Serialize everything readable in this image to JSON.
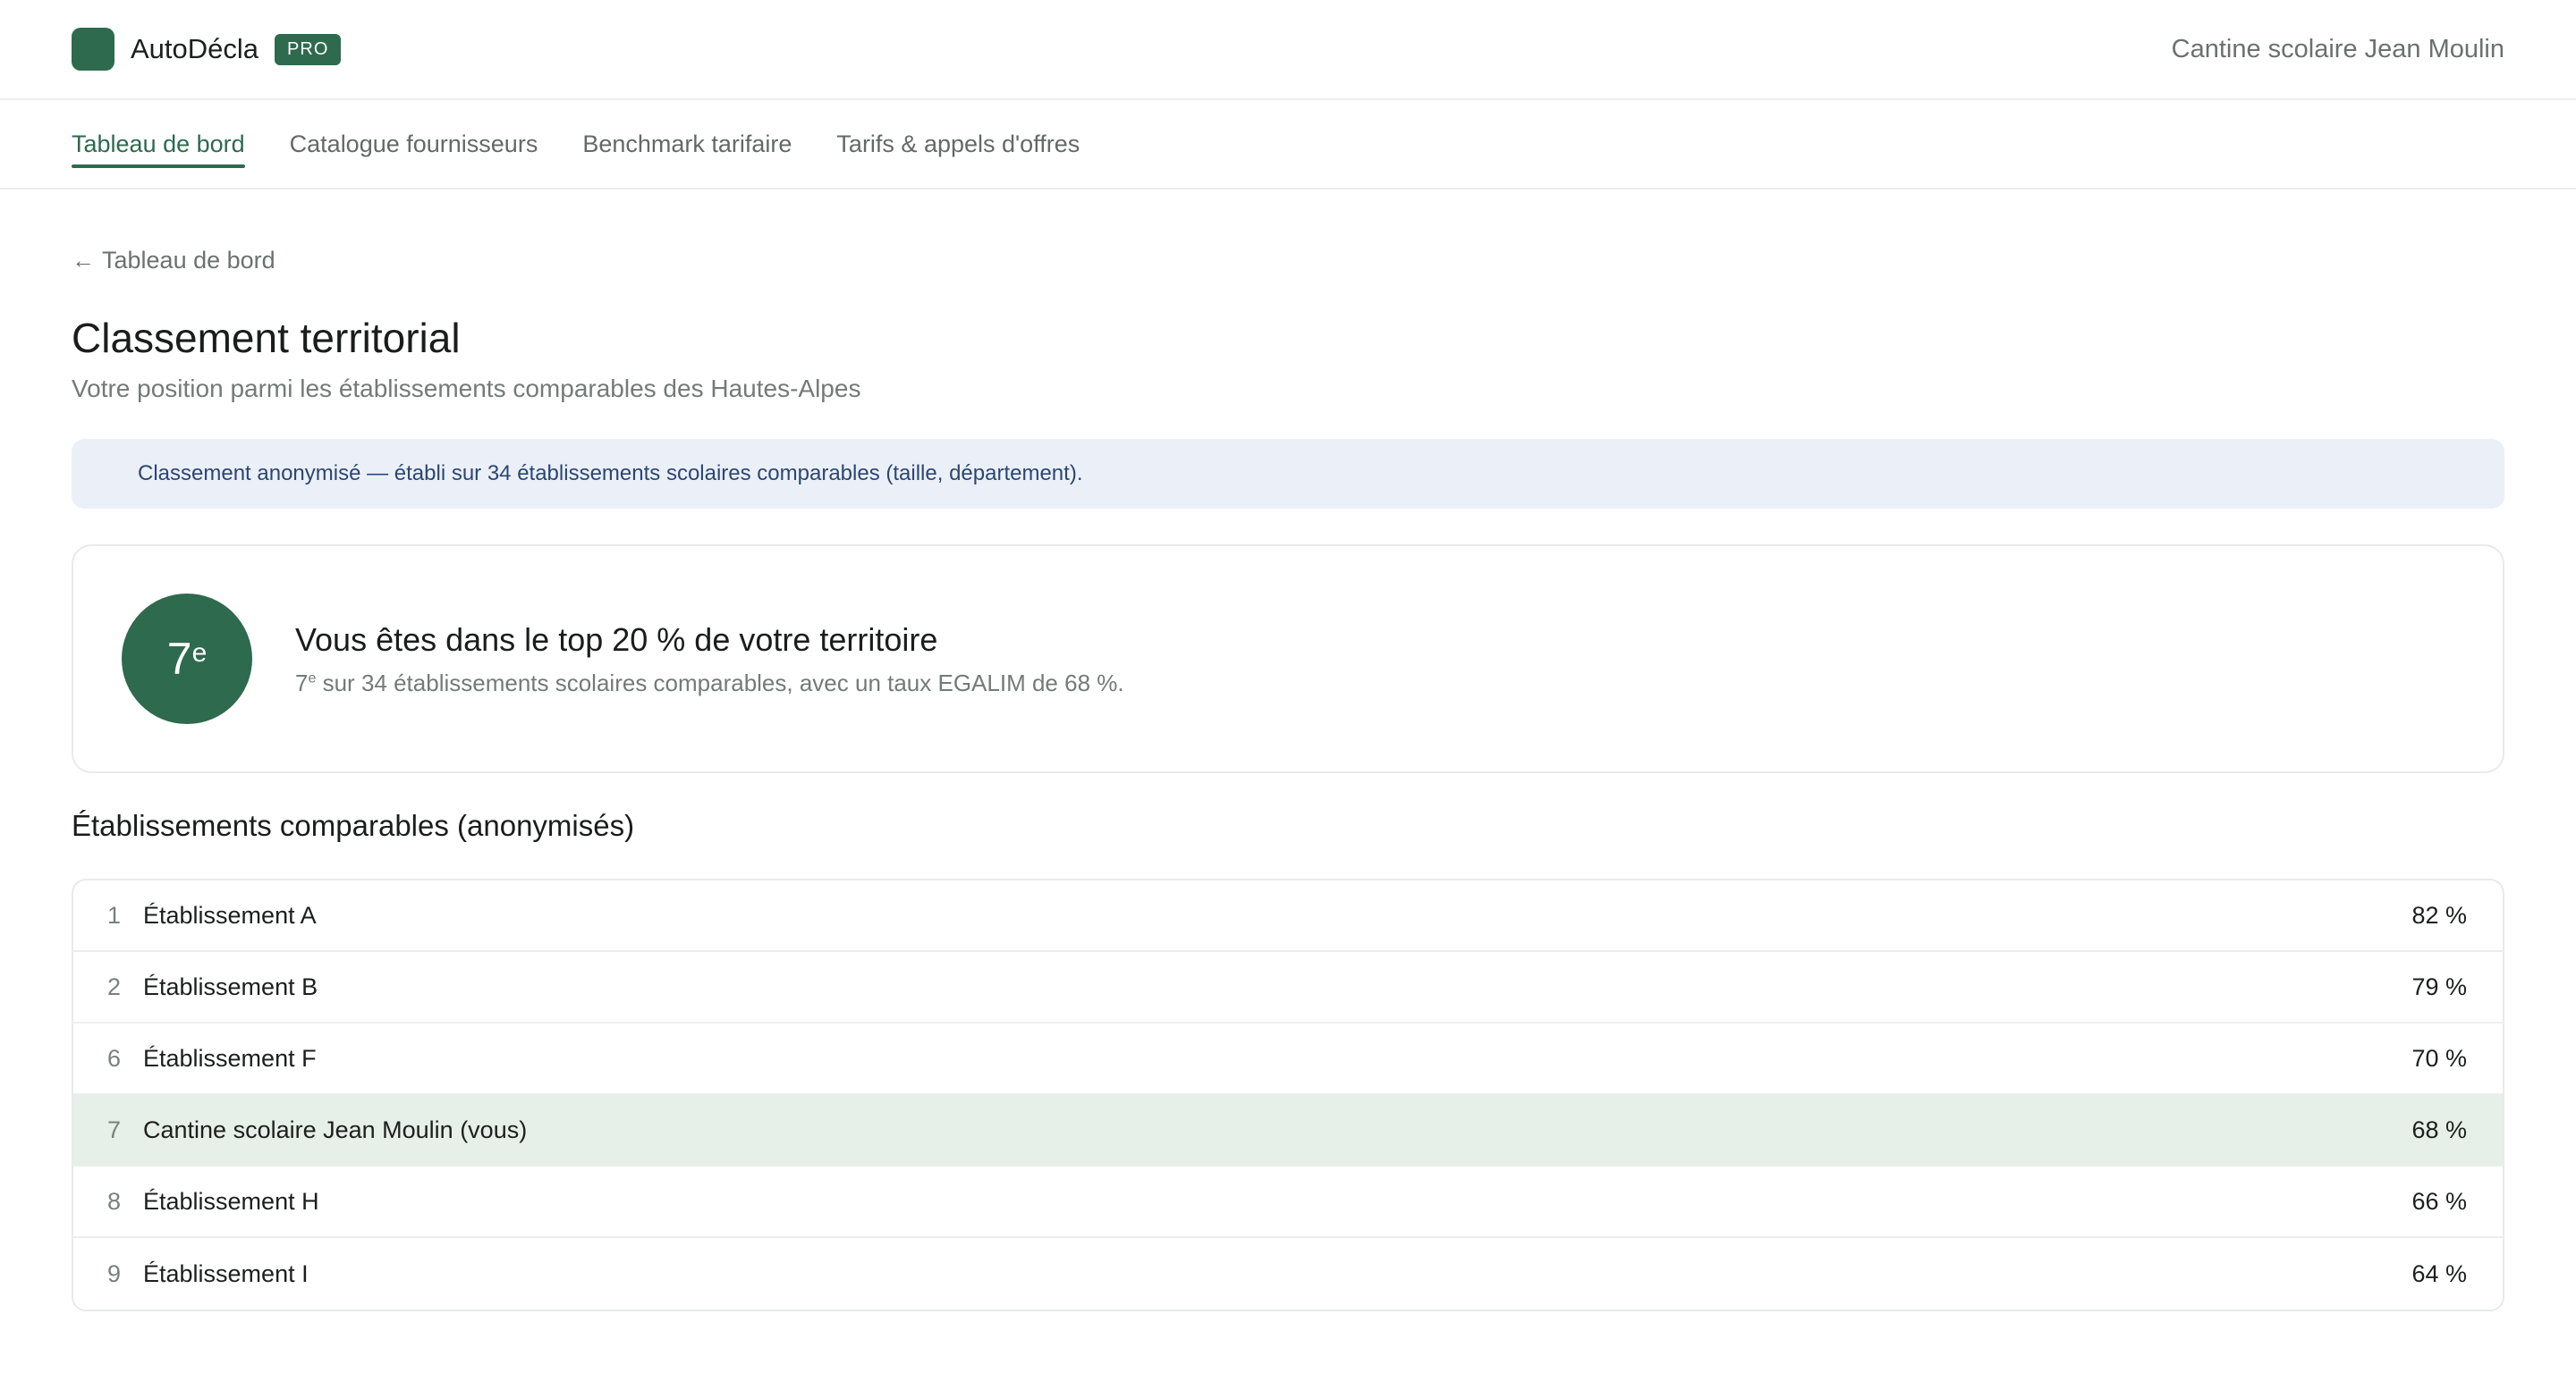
{
  "app": {
    "name": "AutoDécla",
    "badge": "PRO",
    "establishment": "Cantine scolaire Jean Moulin"
  },
  "tabs": [
    {
      "label": "Tableau de bord",
      "active": true
    },
    {
      "label": "Catalogue fournisseurs",
      "active": false
    },
    {
      "label": "Benchmark tarifaire",
      "active": false
    },
    {
      "label": "Tarifs & appels d'offres",
      "active": false
    }
  ],
  "breadcrumb": {
    "back_icon": "arrow-left-icon",
    "label": "Tableau de bord"
  },
  "page": {
    "title": "Classement territorial",
    "subtitle": "Votre position parmi les établissements comparables des Hautes-Alpes"
  },
  "notice": {
    "text": "Classement anonymisé — établi sur 34 établissements scolaires comparables (taille, département)."
  },
  "rank": {
    "number": "7",
    "suffix": "e",
    "title": "Vous êtes dans le top 20 % de votre territoire",
    "detail_suffix": "e",
    "detail_text": " sur 34 établissements scolaires comparables, avec un taux EGALIM de 68 %."
  },
  "comparables": {
    "title": "Établissements comparables (anonymisés)",
    "rows": [
      {
        "rank": "1",
        "name": "Établissement A",
        "rate": "82 %",
        "is_you": false
      },
      {
        "rank": "2",
        "name": "Établissement B",
        "rate": "79 %",
        "is_you": false
      },
      {
        "rank": "6",
        "name": "Établissement F",
        "rate": "70 %",
        "is_you": false
      },
      {
        "rank": "7",
        "name": "Cantine scolaire Jean Moulin (vous)",
        "rate": "68 %",
        "is_you": true
      },
      {
        "rank": "8",
        "name": "Établissement H",
        "rate": "66 %",
        "is_you": false
      },
      {
        "rank": "9",
        "name": "Établissement I",
        "rate": "64 %",
        "is_you": false
      }
    ]
  },
  "colors": {
    "brand": "#2e6a4d",
    "notice_bg": "#ebf0f8",
    "notice_text": "#2c4672",
    "highlight_row": "#e7efe9"
  }
}
